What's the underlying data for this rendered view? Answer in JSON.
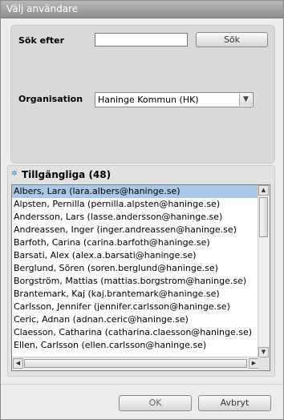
{
  "window": {
    "title": "Välj användare"
  },
  "search": {
    "label": "Sök efter",
    "value": "",
    "button_label": "Sök"
  },
  "organisation": {
    "label": "Organisation",
    "selected": "Haninge Kommun (HK)"
  },
  "available": {
    "heading": "Tillgängliga (48)",
    "items": [
      "Albers, Lara (lara.albers@haninge.se)",
      "Alpsten, Pernilla (pernilla.alpsten@haninge.se)",
      "Andersson, Lars (lasse.andersson@haninge.se)",
      "Andreassen, Inger (inger.andreassen@haninge.se)",
      "Barfoth, Carina (carina.barfoth@haninge.se)",
      "Barsati, Alex (alex.a.barsati@haninge.se)",
      "Berglund, Sören (soren.berglund@haninge.se)",
      "Borgström, Mattias (mattias.borgstrom@haninge.se)",
      "Brantemark, Kaj (kaj.brantemark@haninge.se)",
      "Carlsson, Jennifer (jennifer.carlsson@haninge.se)",
      "Ceric, Adnan (adnan.ceric@haninge.se)",
      "Claesson, Catharina (catharina.claesson@haninge.se)",
      "Ellen, Carlsson (ellen.carlsson@haninge.se)"
    ],
    "selected_index": 0
  },
  "footer": {
    "ok_label": "OK",
    "cancel_label": "Avbryt"
  }
}
